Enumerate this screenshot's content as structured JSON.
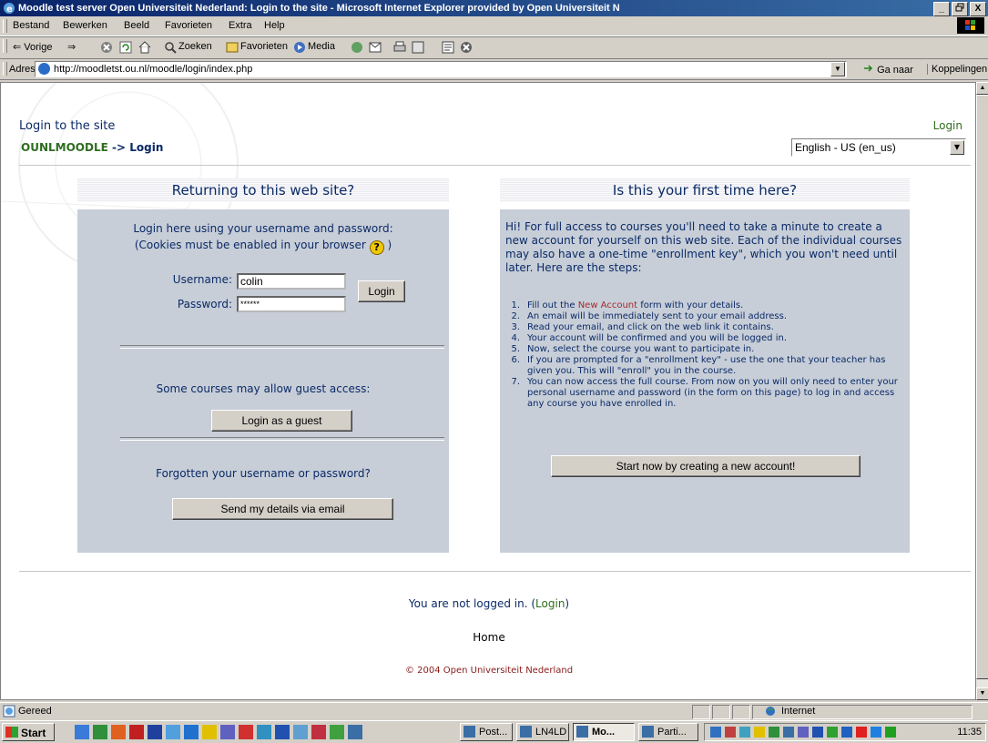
{
  "window": {
    "title": "Moodle test server Open Universiteit Nederland: Login to the site - Microsoft Internet Explorer provided by Open Universiteit N",
    "buttons": [
      "_",
      "̥",
      "X"
    ]
  },
  "menubar": {
    "items": [
      "Bestand",
      "Bewerken",
      "Beeld",
      "Favorieten",
      "Extra",
      "Help"
    ]
  },
  "toolbar": {
    "back": "⇐ Vorige",
    "forward": "⇒",
    "search": "Zoeken",
    "favorites": "Favorieten",
    "media": "Media"
  },
  "addressbar": {
    "label": "Adres",
    "url": "http://moodletst.ou.nl/moodle/login/index.php",
    "go": "Ga naar",
    "links": "Koppelingen"
  },
  "page": {
    "heading": "Login to the site",
    "login_link": "Login",
    "breadcrumb": {
      "site": "OUNLMOODLE",
      "sep": "->",
      "current": "Login"
    },
    "language": "English - US (en_us)"
  },
  "left": {
    "header": "Returning to this web site?",
    "intro_line1": "Login here using your username and password:",
    "intro_line2": "(Cookies must be enabled in your browser",
    "intro_end": ")",
    "help": "?",
    "username_label": "Username:",
    "username_value": "colin",
    "password_label": "Password:",
    "password_value": "******",
    "login_button": "Login",
    "guest_text": "Some courses may allow guest access:",
    "guest_button": "Login as a guest",
    "forgot_text": "Forgotten your username or password?",
    "forgot_button": "Send my details via email"
  },
  "right": {
    "header": "Is this your first time here?",
    "intro": "Hi! For full access to courses you'll need to take a minute to create a new account for yourself on this web site. Each of the individual courses may also have a one-time \"enrollment key\", which you won't need until later. Here are the steps:",
    "step1_pre": "Fill out the ",
    "step1_link": "New Account",
    "step1_post": " form with your details.",
    "steps": [
      "An email will be immediately sent to your email address.",
      "Read your email, and click on the web link it contains.",
      "Your account will be confirmed and you will be logged in.",
      "Now, select the course you want to participate in.",
      "If you are prompted for a \"enrollment key\" - use the one that your teacher has given you. This will \"enroll\" you in the course.",
      "You can now access the full course. From now on you will only need to enter your personal username and password (in the form on this page) to log in and access any course you have enrolled in."
    ],
    "step_numbers": [
      "1.",
      "2.",
      "3.",
      "4.",
      "5.",
      "6.",
      "7."
    ],
    "create_button": "Start now by creating a new account!"
  },
  "footer": {
    "logged_pre": "You are not logged in. (",
    "logged_link": "Login",
    "logged_post": ")",
    "home": "Home",
    "copyright": "© 2004 Open Universiteit Nederland"
  },
  "statusbar": {
    "status": "Gereed",
    "zone": "Internet"
  },
  "taskbar": {
    "start": "Start",
    "tasks": [
      "Post...",
      "LN4LD",
      "Mo...",
      "Parti..."
    ],
    "clock": "11:35"
  },
  "colors": {
    "title_gradient_start": "#0a246a",
    "link_green": "#2e6d1e",
    "text_blue": "#0b2a66",
    "panel_bg": "#c7ced8",
    "new_account_link": "#a52a2a"
  }
}
